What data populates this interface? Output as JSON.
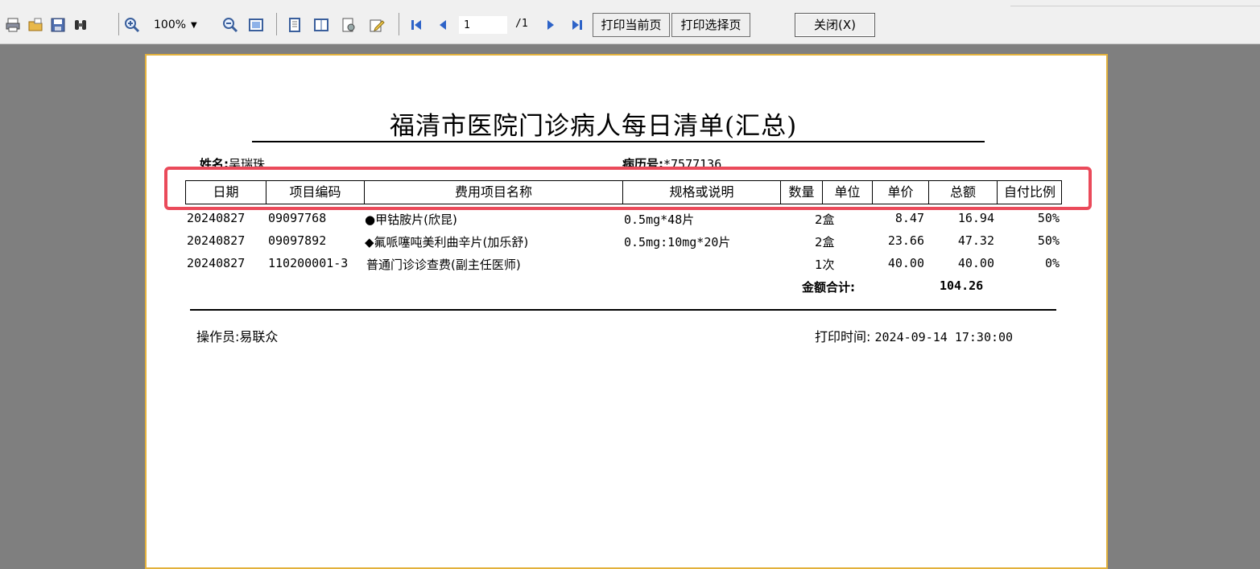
{
  "toolbar": {
    "zoom_value": "100%",
    "page_current": "1",
    "page_total": "/1",
    "print_current_label": "打印当前页",
    "print_selected_label": "打印选择页",
    "close_label": "关闭(X)"
  },
  "report": {
    "title": "福清市医院门诊病人每日清单(汇总)",
    "name_label": "姓名:",
    "name_value": "吴瑞珠",
    "record_label": "病历号:",
    "record_value": "*7577136",
    "columns": [
      "日期",
      "项目编码",
      "费用项目名称",
      "规格或说明",
      "数量",
      "单位",
      "单价",
      "总额",
      "自付比例"
    ],
    "rows": [
      {
        "date": "20240827",
        "code": "09097768",
        "name": "●甲钴胺片(欣昆)",
        "spec": "0.5mg*48片",
        "qty": "2盒",
        "price": "8.47",
        "amount": "16.94",
        "ratio": "50%"
      },
      {
        "date": "20240827",
        "code": "09097892",
        "name": "◆氟哌噻吨美利曲辛片(加乐舒)",
        "spec": "0.5mg:10mg*20片",
        "qty": "2盒",
        "price": "23.66",
        "amount": "47.32",
        "ratio": "50%"
      },
      {
        "date": "20240827",
        "code": "110200001-3",
        "name": "普通门诊诊查费(副主任医师)",
        "spec": "",
        "qty": "1次",
        "price": "40.00",
        "amount": "40.00",
        "ratio": "0%"
      }
    ],
    "total_label": "金额合计:",
    "total_value": "104.26",
    "operator_label": "操作员:",
    "operator_value": "易联众",
    "print_time_label": "打印时间:",
    "print_time_value": "2024-09-14 17:30:00"
  }
}
